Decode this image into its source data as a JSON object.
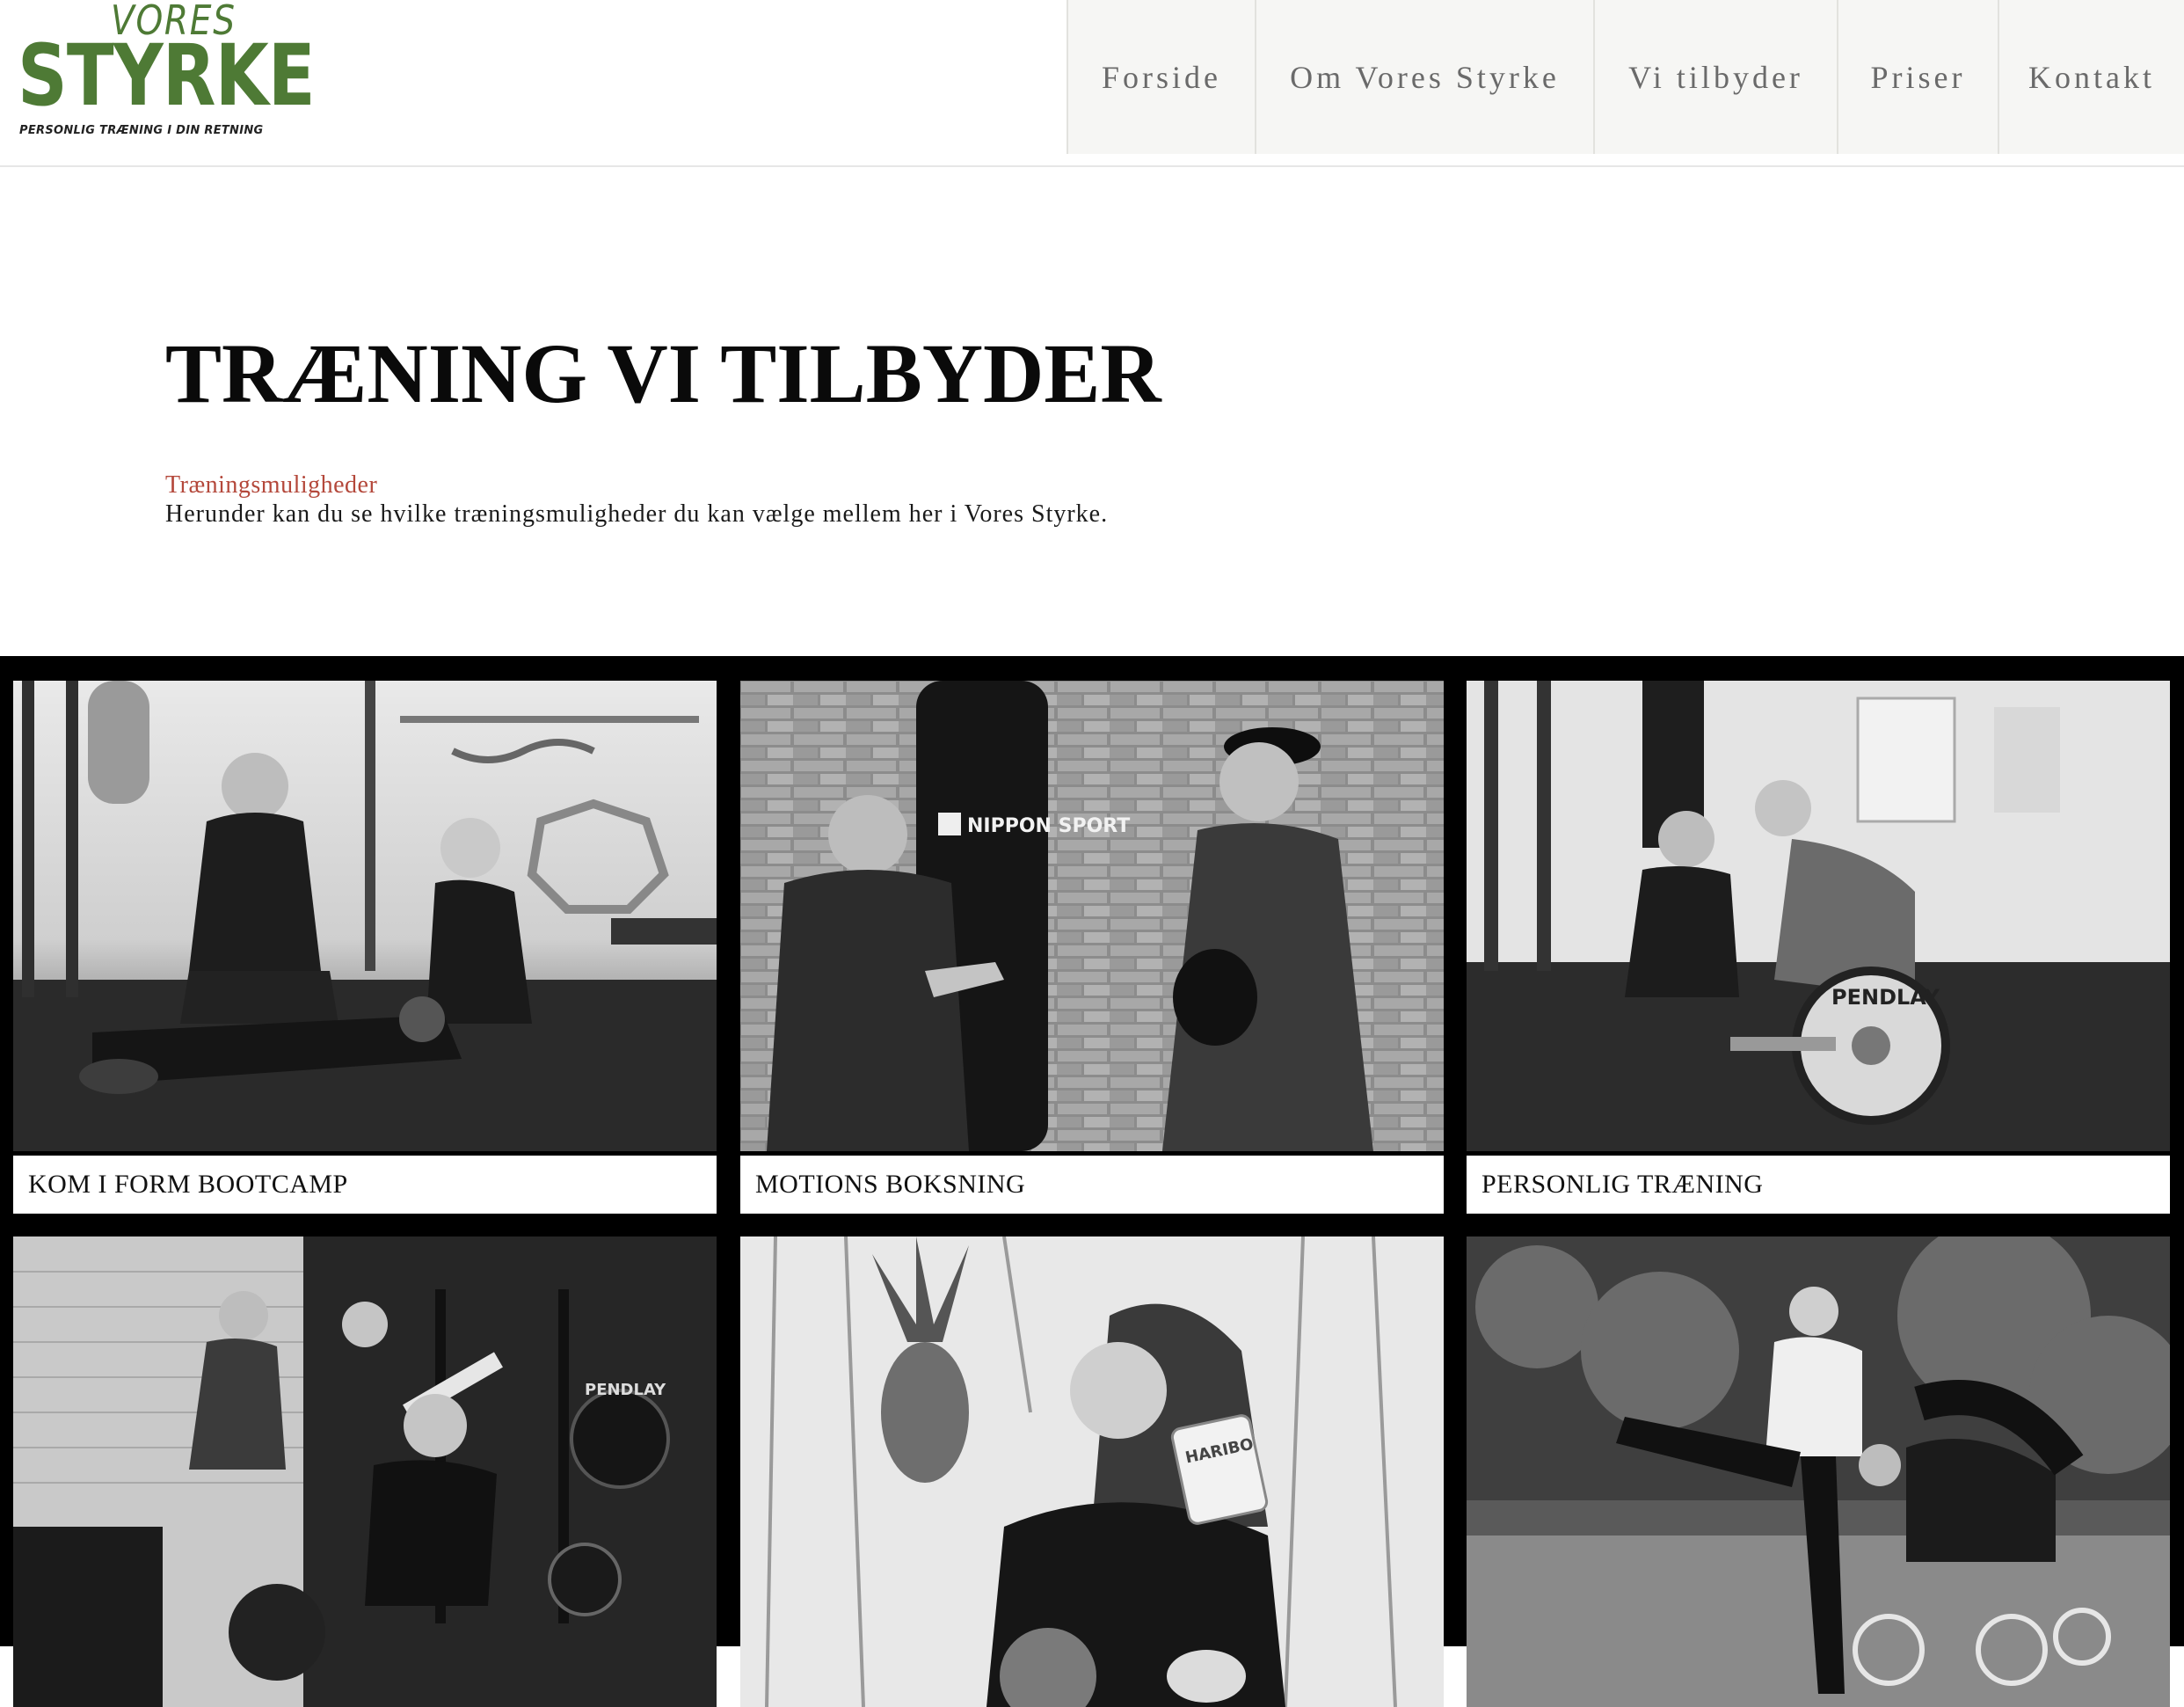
{
  "logo": {
    "vores": "VORES",
    "styrke": "STYRKE",
    "tagline": "PERSONLIG TRÆNING I DIN RETNING"
  },
  "nav": {
    "items": [
      {
        "label": "Forside"
      },
      {
        "label": "Om Vores Styrke"
      },
      {
        "label": "Vi tilbyder"
      },
      {
        "label": "Priser"
      },
      {
        "label": "Kontakt"
      }
    ]
  },
  "intro": {
    "title": "TRÆNING VI TILBYDER",
    "subtitle": "Træningsmuligheder",
    "description": "Herunder kan du se hvilke træningsmuligheder du kan vælge mellem her i Vores Styrke."
  },
  "cards": [
    {
      "caption": "KOM I FORM BOOTCAMP",
      "photo_text": ""
    },
    {
      "caption": "MOTIONS BOKSNING",
      "photo_text": "NIPPON SPORT"
    },
    {
      "caption": "PERSONLIG TRÆNING",
      "photo_text": "PENDLAY"
    },
    {
      "caption": "",
      "photo_text": "PENDLAY"
    },
    {
      "caption": "",
      "photo_text": "HARIBO"
    },
    {
      "caption": "",
      "photo_text": ""
    }
  ],
  "colors": {
    "brand_green": "#4e7a35",
    "subtitle_red": "#b4483b",
    "nav_bg": "#f6f6f4",
    "grid_bg": "#000000"
  }
}
